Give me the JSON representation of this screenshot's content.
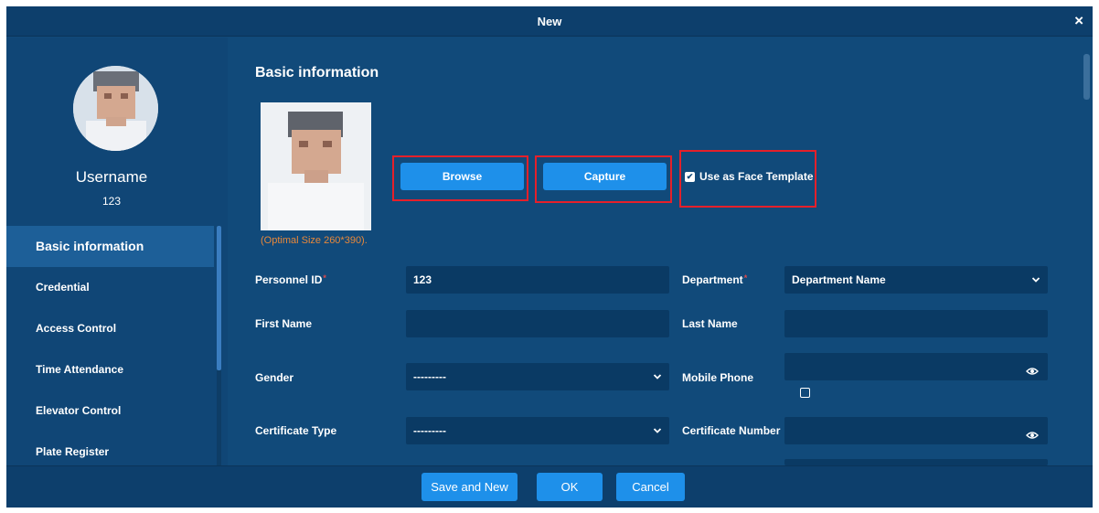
{
  "window": {
    "title": "New",
    "close_glyph": "×"
  },
  "sidebar": {
    "username": "Username",
    "user_id": "123",
    "items": [
      {
        "label": "Basic information",
        "active": true
      },
      {
        "label": "Credential"
      },
      {
        "label": "Access Control"
      },
      {
        "label": "Time Attendance"
      },
      {
        "label": "Elevator Control"
      },
      {
        "label": "Plate Register"
      }
    ]
  },
  "main": {
    "section_title": "Basic information",
    "photo_hint": "(Optimal Size 260*390).",
    "browse_label": "Browse",
    "capture_label": "Capture",
    "face_template_label": "Use as Face Template",
    "face_template_checked": true
  },
  "form": {
    "personnel_id": {
      "label": "Personnel ID",
      "required": "*",
      "value": "123"
    },
    "department": {
      "label": "Department",
      "required": "*",
      "value": "Department Name"
    },
    "first_name": {
      "label": "First Name",
      "value": ""
    },
    "last_name": {
      "label": "Last Name",
      "value": ""
    },
    "gender": {
      "label": "Gender",
      "value": "---------"
    },
    "mobile_phone": {
      "label": "Mobile Phone",
      "value": ""
    },
    "certificate_type": {
      "label": "Certificate Type",
      "value": "---------"
    },
    "certificate_number": {
      "label": "Certificate Number",
      "value": ""
    }
  },
  "footer": {
    "save_new_label": "Save and New",
    "ok_label": "OK",
    "cancel_label": "Cancel"
  },
  "icons": {
    "close": "close-icon",
    "chevron": "chevron-down-icon",
    "eye": "eye-icon",
    "check": "check-icon"
  },
  "colors": {
    "background": "#114a7a",
    "header": "#0d3f6c",
    "accent": "#1e90ea",
    "highlight": "#e5202a",
    "hint": "#e8883a",
    "field": "#0a3a64"
  }
}
